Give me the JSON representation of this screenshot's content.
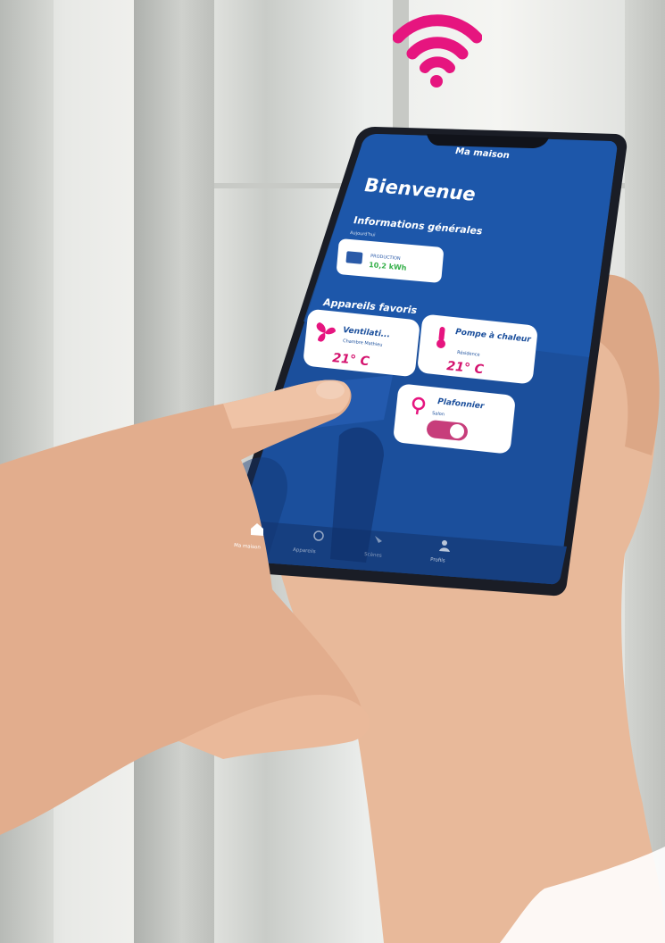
{
  "app": {
    "title": "Ma maison",
    "welcome": "Bienvenue",
    "info_heading": "Informations générales",
    "info_sub": "Aujourd'hui",
    "production_label": "PRODUCTION",
    "production_value": "10,2 kWh",
    "favorites_heading": "Appareils favoris",
    "cards": [
      {
        "title": "Ventilati...",
        "sub": "Chambre Mathieu",
        "value": "21° C",
        "icon": "fan-icon"
      },
      {
        "title": "Pompe à chaleur",
        "sub": "Résidence",
        "value": "21° C",
        "icon": "thermometer-icon"
      },
      {
        "title": "Plafonnier",
        "sub": "Salon",
        "icon": "bulb-icon",
        "toggle_on": true
      }
    ],
    "nav": [
      {
        "label": "Ma maison",
        "icon": "home-icon"
      },
      {
        "label": "Appareils",
        "icon": "devices-icon"
      },
      {
        "label": "Scènes",
        "icon": "scenes-icon"
      },
      {
        "label": "Profils",
        "icon": "profile-icon"
      }
    ]
  },
  "colors": {
    "screen_blue": "#1b4f9c",
    "screen_dark": "#0f2d66",
    "wifi_pink": "#e6157f",
    "card_bg": "#ffffff",
    "value_pink": "#d4146f",
    "production_green": "#36b04a"
  }
}
